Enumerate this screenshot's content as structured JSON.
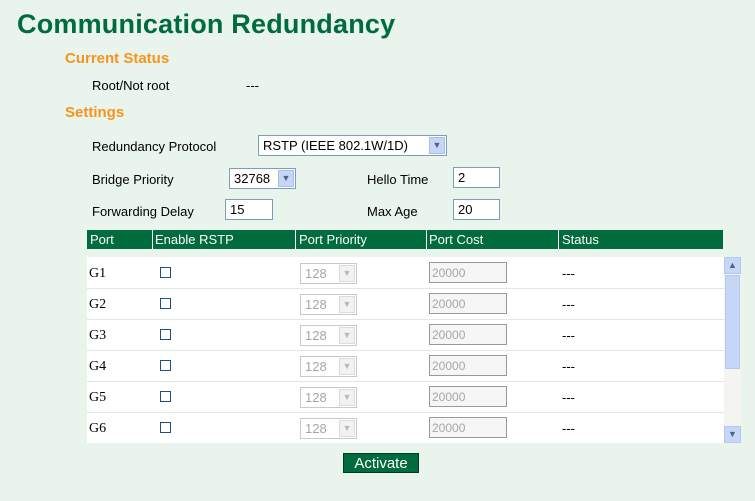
{
  "page_title": "Communication Redundancy",
  "current_status": {
    "title": "Current Status",
    "root_label": "Root/Not root",
    "root_value": "---"
  },
  "settings": {
    "title": "Settings",
    "redundancy_protocol_label": "Redundancy Protocol",
    "redundancy_protocol_value": "RSTP (IEEE 802.1W/1D)",
    "bridge_priority_label": "Bridge Priority",
    "bridge_priority_value": "32768",
    "hello_time_label": "Hello Time",
    "hello_time_value": "2",
    "forwarding_delay_label": "Forwarding Delay",
    "forwarding_delay_value": "15",
    "max_age_label": "Max Age",
    "max_age_value": "20"
  },
  "table": {
    "columns": [
      "Port",
      "Enable RSTP",
      "Port Priority",
      "Port Cost",
      "Status"
    ],
    "rows": [
      {
        "port": "G1",
        "priority": "128",
        "cost": "20000",
        "status": "---"
      },
      {
        "port": "G2",
        "priority": "128",
        "cost": "20000",
        "status": "---"
      },
      {
        "port": "G3",
        "priority": "128",
        "cost": "20000",
        "status": "---"
      },
      {
        "port": "G4",
        "priority": "128",
        "cost": "20000",
        "status": "---"
      },
      {
        "port": "G5",
        "priority": "128",
        "cost": "20000",
        "status": "---"
      },
      {
        "port": "G6",
        "priority": "128",
        "cost": "20000",
        "status": "---"
      }
    ]
  },
  "activate_label": "Activate",
  "colors": {
    "title_green": "#006b3c",
    "section_orange": "#f7941d",
    "background": "#e8f4ec"
  }
}
